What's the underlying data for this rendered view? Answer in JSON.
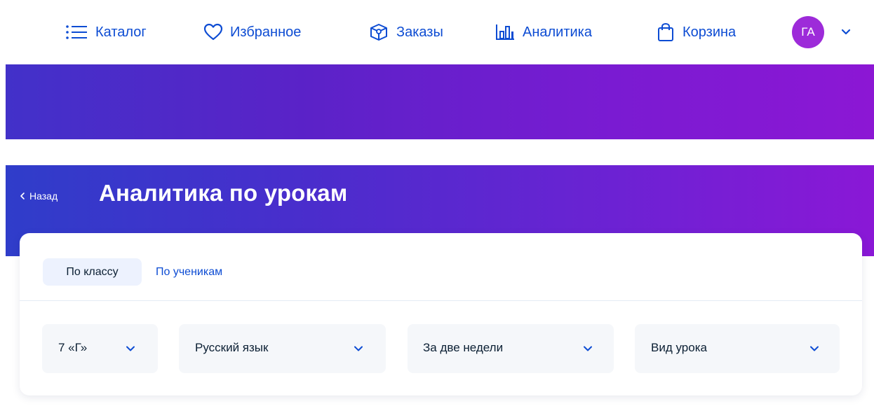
{
  "nav": {
    "items": [
      {
        "label": "Каталог",
        "icon": "list-icon"
      },
      {
        "label": "Избранное",
        "icon": "heart-icon"
      },
      {
        "label": "Заказы",
        "icon": "orders-icon"
      },
      {
        "label": "Аналитика",
        "icon": "bar-chart-icon"
      },
      {
        "label": "Корзина",
        "icon": "bag-icon"
      }
    ],
    "avatar_initials": "ГА"
  },
  "page": {
    "back_label": "Назад",
    "title": "Аналитика по урокам"
  },
  "tabs": [
    {
      "label": "По классу",
      "active": true
    },
    {
      "label": "По ученикам",
      "active": false
    }
  ],
  "filters": [
    {
      "value": "7 «Г»"
    },
    {
      "value": "Русский язык"
    },
    {
      "value": "За две недели"
    },
    {
      "value": "Вид урока"
    }
  ],
  "colors": {
    "accent": "#0d4cd3",
    "avatar": "#9d2bd9",
    "gradient_start": "#2f3dca",
    "gradient_end": "#8a18d6",
    "tab_active_bg": "#edf2fe",
    "select_bg": "#f5f7fa"
  }
}
